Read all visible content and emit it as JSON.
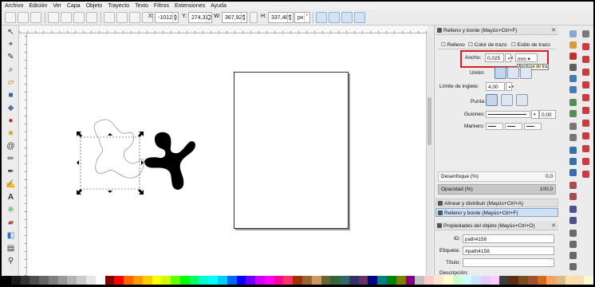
{
  "menu": [
    "Archivo",
    "Edición",
    "Ver",
    "Capa",
    "Objeto",
    "Trayecto",
    "Texto",
    "Filtros",
    "Extensiones",
    "Ayuda"
  ],
  "toolbar": {
    "x_label": "X:",
    "x_value": "-1012,9",
    "y_label": "Y:",
    "y_value": "274,312",
    "w_label": "W:",
    "w_value": "367,925",
    "h_label": "H:",
    "h_value": "337,485",
    "unit": "px"
  },
  "fill_stroke_panel": {
    "title": "Relleno y borde (Mayús+Ctrl+F)",
    "tabs": [
      "Relleno",
      "Color de trazo",
      "Estilo de trazo"
    ],
    "width_label": "Ancho:",
    "width_value": "0,025",
    "width_unit": "mm",
    "tooltip": "Anchura de trazo",
    "join_label": "Unión:",
    "miter_label": "Límite de inglete:",
    "miter_value": "4,00",
    "cap_label": "Punta:",
    "dashes_label": "Guiones:",
    "dash_offset": "0,00",
    "markers_label": "Markers:",
    "blur_label": "Desenfoque (%)",
    "blur_value": "0,0",
    "opacity_label": "Opacidad (%)",
    "opacity_value": "100,0"
  },
  "collapsed_panels": {
    "align": "Alinear y distribuir (Mayús+Ctrl+A)",
    "fill": "Relleno y borde (Mayús+Ctrl+F)"
  },
  "object_props": {
    "title": "Propiedades del objeto (Mayús+Ctrl+O)",
    "id_label": "ID:",
    "id_value": "path4158",
    "label_label": "Etiqueta:",
    "label_value": "#path4158",
    "title_label": "Título:",
    "title_value": "",
    "desc_label": "Descripción:"
  },
  "colors": {
    "accent": "#d42020",
    "palette": [
      "#000000",
      "#1a1a1a",
      "#333333",
      "#4d4d4d",
      "#666666",
      "#808080",
      "#999999",
      "#b3b3b3",
      "#cccccc",
      "#e6e6e6",
      "#ffffff",
      "#800000",
      "#ff0000",
      "#ff6600",
      "#ff9900",
      "#ffcc00",
      "#ffff00",
      "#ccff00",
      "#66ff00",
      "#00ff00",
      "#00ff66",
      "#00ffcc",
      "#00ffff",
      "#00ccff",
      "#0066ff",
      "#0000ff",
      "#6600ff",
      "#cc00ff",
      "#ff00ff",
      "#ff0099",
      "#ff3366",
      "#993300",
      "#996633",
      "#cc9966",
      "#666633",
      "#336633",
      "#336666",
      "#333366",
      "#663366",
      "#000080",
      "#008080",
      "#008000",
      "#808000",
      "#800080",
      "#c0c0c0",
      "#ffcccc",
      "#ffe5cc",
      "#ffffcc",
      "#ccffcc",
      "#ccffff",
      "#cce5ff",
      "#e5ccff",
      "#ffccff",
      "#3d3d3d",
      "#5a2e0e",
      "#7a4c1f",
      "#a0522d",
      "#d2691e",
      "#f4a460",
      "#deb887",
      "#ffdead",
      "#f5deb3",
      "#fafad2"
    ]
  },
  "icons": [
    "select-icon",
    "node-icon",
    "tweak-icon",
    "zoom-icon",
    "measure-icon",
    "rect-icon",
    "3dbox-icon",
    "ellipse-icon",
    "star-icon",
    "spiral-icon",
    "pencil-icon",
    "pen-icon",
    "calligraphy-icon",
    "text-icon",
    "spray-icon",
    "eraser-icon",
    "bucket-icon",
    "gradient-icon",
    "mesh-icon",
    "dropper-icon"
  ]
}
